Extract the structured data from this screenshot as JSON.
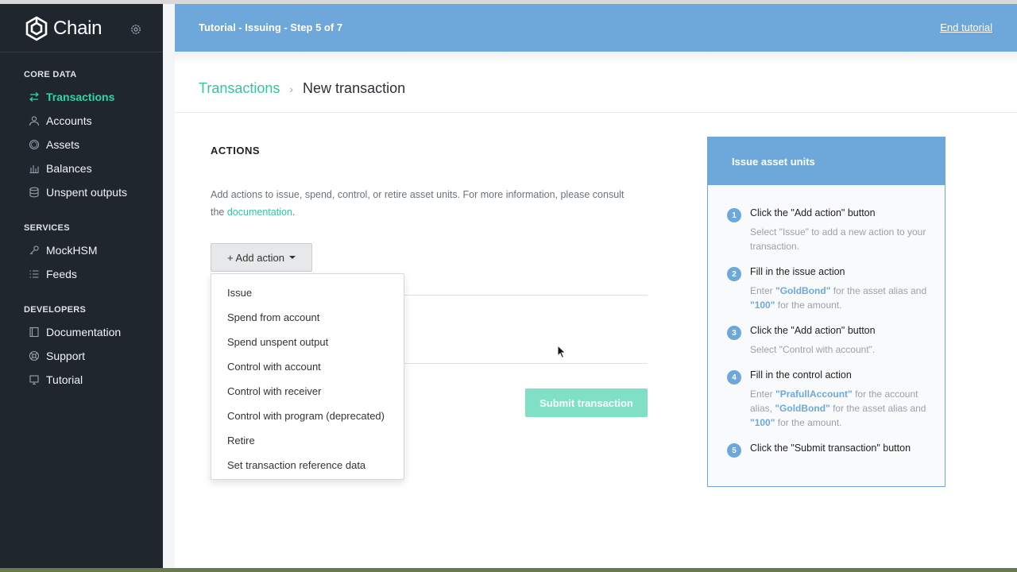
{
  "app": {
    "brand_name": "Chain",
    "settings_icon": "gear-icon",
    "accent_color": "#31c79b",
    "tutorial_color": "#6ea8db",
    "sidebar_color": "#1f262e"
  },
  "sidebar": {
    "sections": [
      {
        "title": "CORE DATA",
        "items": [
          {
            "label": "Transactions",
            "icon": "arrows-exchange-icon",
            "active": true
          },
          {
            "label": "Accounts",
            "icon": "user-icon",
            "active": false
          },
          {
            "label": "Assets",
            "icon": "circle-icon",
            "active": false
          },
          {
            "label": "Balances",
            "icon": "bar-chart-icon",
            "active": false
          },
          {
            "label": "Unspent outputs",
            "icon": "database-icon",
            "active": false
          }
        ]
      },
      {
        "title": "SERVICES",
        "items": [
          {
            "label": "MockHSM",
            "icon": "key-icon",
            "active": false
          },
          {
            "label": "Feeds",
            "icon": "list-icon",
            "active": false
          }
        ]
      },
      {
        "title": "DEVELOPERS",
        "items": [
          {
            "label": "Documentation",
            "icon": "book-icon",
            "active": false
          },
          {
            "label": "Support",
            "icon": "lifebuoy-icon",
            "active": false
          },
          {
            "label": "Tutorial",
            "icon": "monitor-icon",
            "active": false
          }
        ]
      }
    ]
  },
  "tutorial_bar": {
    "title": "Tutorial - Issuing - Step 5 of 7",
    "end_label": "End tutorial"
  },
  "breadcrumb": {
    "parent": "Transactions",
    "separator": "›",
    "current": "New transaction"
  },
  "actions": {
    "title": "ACTIONS",
    "description_prefix": "Add actions to issue, spend, control, or retire asset units. For more information, please consult the ",
    "doc_link": "documentation",
    "description_suffix": ".",
    "add_button_label": "+ Add action"
  },
  "dropdown": {
    "items": [
      "Issue",
      "Spend from account",
      "Spend unspent output",
      "Control with account",
      "Control with receiver",
      "Control with program (deprecated)",
      "Retire",
      "Set transaction reference data"
    ]
  },
  "submit_label": "Submit transaction",
  "tutorial_panel": {
    "title": "Issue asset units",
    "steps": [
      {
        "num": "1",
        "title": "Click the \"Add action\" button",
        "desc": [
          {
            "t": "Select \"Issue\" to add a new action to your transaction.",
            "h": false
          }
        ]
      },
      {
        "num": "2",
        "title": "Fill in the issue action",
        "desc": [
          {
            "t": "Enter ",
            "h": false
          },
          {
            "t": "\"GoldBond\"",
            "h": true
          },
          {
            "t": " for the asset alias and ",
            "h": false
          },
          {
            "t": "\"100\"",
            "h": true
          },
          {
            "t": " for the amount.",
            "h": false
          }
        ]
      },
      {
        "num": "3",
        "title": "Click the \"Add action\" button",
        "desc": [
          {
            "t": "Select \"Control with account\".",
            "h": false
          }
        ]
      },
      {
        "num": "4",
        "title": "Fill in the control action",
        "desc": [
          {
            "t": "Enter ",
            "h": false
          },
          {
            "t": "\"PrafullAccount\"",
            "h": true
          },
          {
            "t": " for the account alias, ",
            "h": false
          },
          {
            "t": "\"GoldBond\"",
            "h": true
          },
          {
            "t": " for the asset alias and ",
            "h": false
          },
          {
            "t": "\"100\"",
            "h": true
          },
          {
            "t": " for the amount.",
            "h": false
          }
        ]
      },
      {
        "num": "5",
        "title": "Click the \"Submit transaction\" button",
        "desc": []
      }
    ]
  }
}
